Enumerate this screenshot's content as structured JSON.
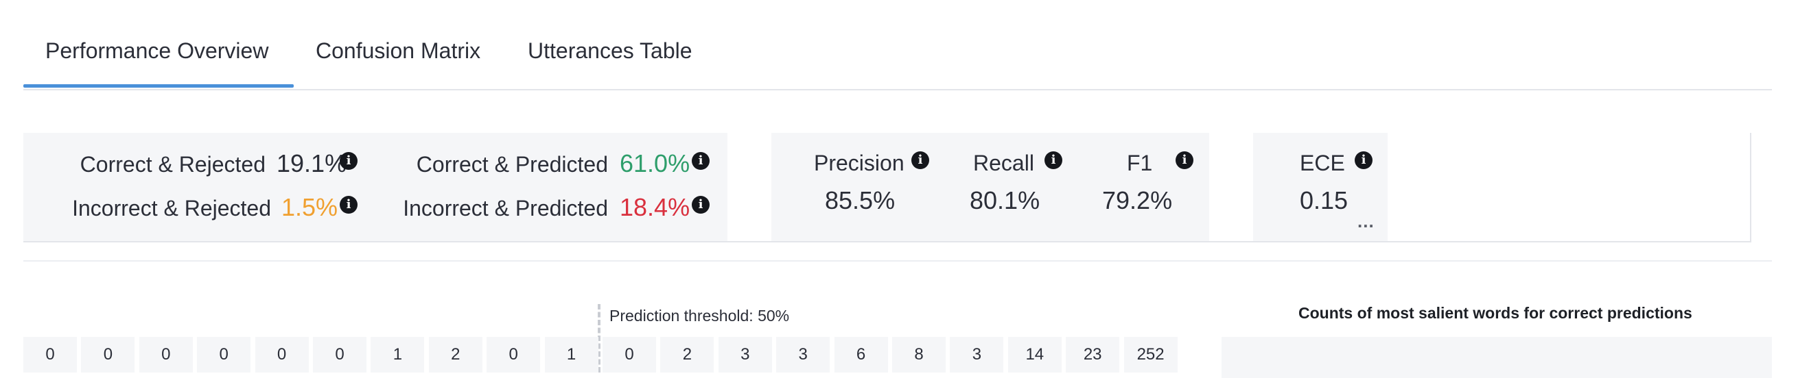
{
  "tabs": [
    {
      "label": "Performance Overview",
      "active": true
    },
    {
      "label": "Confusion Matrix",
      "active": false
    },
    {
      "label": "Utterances Table",
      "active": false
    }
  ],
  "colors": {
    "accent": "#4a90d9",
    "green": "#2e9e6b",
    "orange": "#f0a030",
    "red": "#d9303e",
    "dark": "#2b2e38",
    "card_bg": "#f5f6f8"
  },
  "outcomes": {
    "correct_rejected": {
      "label": "Correct & Rejected",
      "value": "19.1%"
    },
    "incorrect_rejected": {
      "label": "Incorrect & Rejected",
      "value": "1.5%"
    },
    "correct_predicted": {
      "label": "Correct & Predicted",
      "value": "61.0%"
    },
    "incorrect_predicted": {
      "label": "Incorrect & Predicted",
      "value": "18.4%"
    }
  },
  "metrics": {
    "precision": {
      "label": "Precision",
      "value": "85.5%"
    },
    "recall": {
      "label": "Recall",
      "value": "80.1%"
    },
    "f1": {
      "label": "F1",
      "value": "79.2%"
    },
    "ece": {
      "label": "ECE",
      "value": "0.15"
    }
  },
  "more_icon": "more-horizontal-icon",
  "more_text": "...",
  "threshold": {
    "label": "Prediction threshold: 50%"
  },
  "bins_below": [
    "0",
    "0",
    "0",
    "0",
    "0",
    "0",
    "1",
    "2",
    "0",
    "1"
  ],
  "bins_above": [
    "0",
    "2",
    "3",
    "3",
    "6",
    "8",
    "3",
    "14",
    "23",
    "252"
  ],
  "salient": {
    "title": "Counts of most salient words for correct predictions"
  }
}
